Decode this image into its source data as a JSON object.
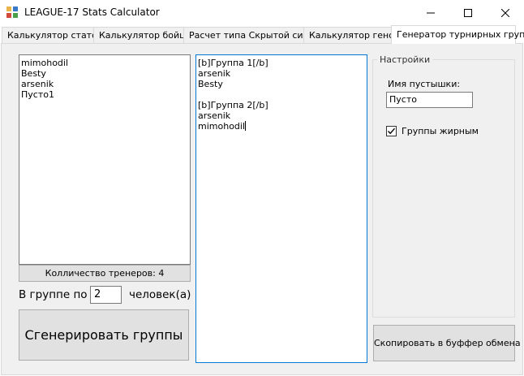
{
  "window": {
    "title": "LEAGUE-17 Stats Calculator",
    "controls": [
      "minimize-icon",
      "maximize-icon",
      "close-icon"
    ]
  },
  "tabs": [
    {
      "label": "Калькулятор статов",
      "active": false
    },
    {
      "label": "Калькулятор бойца",
      "active": false
    },
    {
      "label": "Расчет типа Скрытой силы",
      "active": false
    },
    {
      "label": "Калькулятор генов",
      "active": false
    },
    {
      "label": "Генератор турнирных групп",
      "active": true
    }
  ],
  "trainers": {
    "items": [
      "mimohodil",
      "Besty",
      "arsenik",
      "Пусто1"
    ],
    "count_label": "Колличество тренеров: 4"
  },
  "group_size": {
    "prefix": "В группе по",
    "value": "2",
    "suffix": "человек(а)"
  },
  "generate_button": "Сгенерировать группы",
  "output_lines": [
    "[b]Группа 1[/b]",
    "arsenik",
    "Besty",
    "",
    "[b]Группа 2[/b]",
    "arsenik",
    "mimohodil"
  ],
  "settings": {
    "legend": "Настройки",
    "desert_label": "Имя пустышки:",
    "desert_value": "Пусто",
    "bold_groups_label": "Группы жирным",
    "bold_groups_checked": true
  },
  "copy_button": "Скопировать в буффер обмена"
}
